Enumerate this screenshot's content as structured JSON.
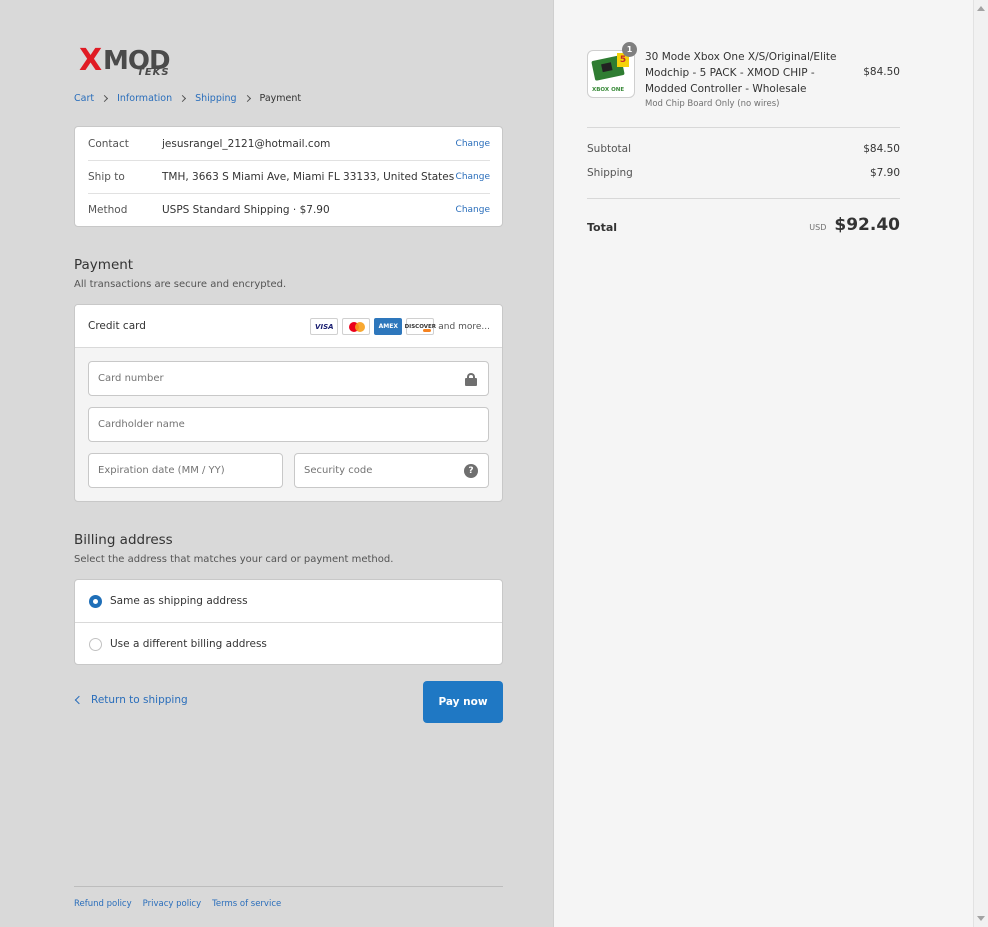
{
  "logo": {
    "x": "X",
    "mod": "MOD",
    "teks": "TEKS"
  },
  "breadcrumb": [
    {
      "label": "Cart"
    },
    {
      "label": "Information"
    },
    {
      "label": "Shipping"
    },
    {
      "label": "Payment"
    }
  ],
  "review": {
    "contact": {
      "label": "Contact",
      "value": "jesusrangel_2121@hotmail.com",
      "action": "Change"
    },
    "ship_to": {
      "label": "Ship to",
      "value": "TMH, 3663 S Miami Ave, Miami FL 33133, United States",
      "action": "Change"
    },
    "method": {
      "label": "Method",
      "value": "USPS Standard Shipping · $7.90",
      "action": "Change"
    }
  },
  "payment": {
    "title": "Payment",
    "subtitle": "All transactions are secure and encrypted.",
    "method_label": "Credit card",
    "brands": {
      "visa": "VISA",
      "amex": "AMEX",
      "discover": "DISCOVER",
      "more": "and more..."
    },
    "fields": {
      "card_number": "Card number",
      "cardholder": "Cardholder name",
      "expiry": "Expiration date (MM / YY)",
      "security": "Security code"
    }
  },
  "billing": {
    "title": "Billing address",
    "subtitle": "Select the address that matches your card or payment method.",
    "options": [
      {
        "label": "Same as shipping address",
        "selected": true
      },
      {
        "label": "Use a different billing address",
        "selected": false
      }
    ]
  },
  "actions": {
    "return": "Return to shipping",
    "pay": "Pay now"
  },
  "footer": [
    "Refund policy",
    "Privacy policy",
    "Terms of service"
  ],
  "summary": {
    "product": {
      "title": "30 Mode Xbox One X/S/Original/Elite Modchip - 5 PACK - XMOD CHIP - Modded Controller - Wholesale",
      "variant": "Mod Chip Board Only (no wires)",
      "price": "$84.50",
      "quantity": "1",
      "thumb_badge": "5",
      "thumb_text": "XBOX ONE"
    },
    "subtotal": {
      "label": "Subtotal",
      "value": "$84.50"
    },
    "shipping": {
      "label": "Shipping",
      "value": "$7.90"
    },
    "total": {
      "label": "Total",
      "currency": "USD",
      "value": "$92.40"
    }
  },
  "colors": {
    "accent": "#1f78c4",
    "link": "#2a6ebb",
    "left_bg": "#d9d9d9",
    "logo_red": "#e01b24"
  }
}
